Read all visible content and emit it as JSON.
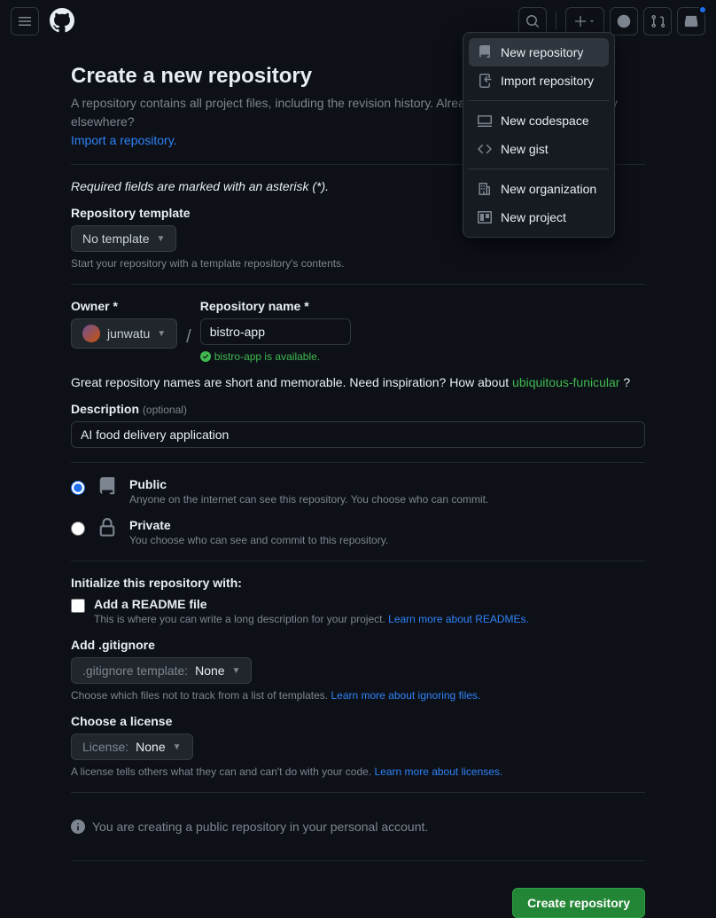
{
  "header": {
    "plus_menu": {
      "items": [
        {
          "label": "New repository",
          "icon": "repo"
        },
        {
          "label": "Import repository",
          "icon": "import"
        },
        {
          "label": "New codespace",
          "icon": "codespace"
        },
        {
          "label": "New gist",
          "icon": "gist"
        },
        {
          "label": "New organization",
          "icon": "org"
        },
        {
          "label": "New project",
          "icon": "project"
        }
      ]
    }
  },
  "page": {
    "title": "Create a new repository",
    "subtitle_pre": "A repository contains all project files, including the revision history. Already have a project repository elsewhere?",
    "import_link": "Import a repository.",
    "required_note": "Required fields are marked with an asterisk (*).",
    "template": {
      "label": "Repository template",
      "value": "No template",
      "hint": "Start your repository with a template repository's contents."
    },
    "owner": {
      "label": "Owner *",
      "value": "junwatu"
    },
    "repo_name": {
      "label": "Repository name *",
      "value": "bistro-app",
      "available_msg": "bistro-app is available."
    },
    "inspiration": {
      "text_pre": "Great repository names are short and memorable. Need inspiration? How about ",
      "suggestion": "ubiquitous-funicular",
      "text_post": " ?"
    },
    "description": {
      "label": "Description",
      "optional": "(optional)",
      "value": "AI food delivery application"
    },
    "visibility": {
      "public": {
        "title": "Public",
        "desc": "Anyone on the internet can see this repository. You choose who can commit."
      },
      "private": {
        "title": "Private",
        "desc": "You choose who can see and commit to this repository."
      }
    },
    "init": {
      "title": "Initialize this repository with:",
      "readme": {
        "label": "Add a README file",
        "desc": "This is where you can write a long description for your project. ",
        "link": "Learn more about READMEs."
      }
    },
    "gitignore": {
      "label": "Add .gitignore",
      "select_label": ".gitignore template: ",
      "select_value": "None",
      "hint": "Choose which files not to track from a list of templates. ",
      "link": "Learn more about ignoring files."
    },
    "license": {
      "label": "Choose a license",
      "select_label": "License: ",
      "select_value": "None",
      "hint": "A license tells others what they can and can't do with your code. ",
      "link": "Learn more about licenses."
    },
    "banner": "You are creating a public repository in your personal account.",
    "submit": "Create repository"
  }
}
